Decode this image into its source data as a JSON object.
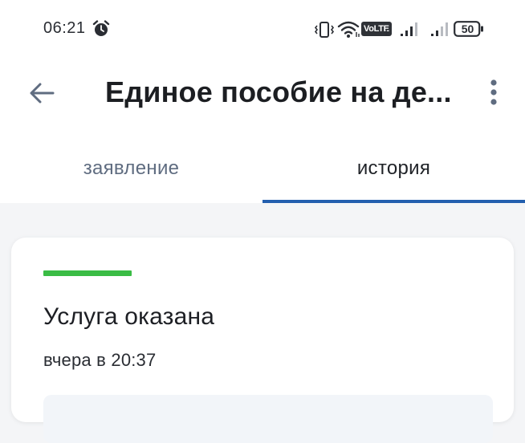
{
  "status_bar": {
    "time": "06:21",
    "volte": "VoLTE",
    "sim_index": "1",
    "battery": "50",
    "icons": [
      "alarm-icon",
      "vibrate-icon",
      "wifi-icon",
      "signal-icon",
      "battery-icon"
    ]
  },
  "header": {
    "title": "Единое пособие на де...",
    "back_icon": "arrow-left-icon",
    "more_icon": "more-vertical-icon"
  },
  "tabs": [
    {
      "label": "заявление",
      "active": false
    },
    {
      "label": "история",
      "active": true
    }
  ],
  "colors": {
    "accent": "#235fae",
    "success": "#3abc45",
    "inactive_tab": "#5f6c80"
  },
  "history": {
    "items": [
      {
        "status": "Услуга оказана",
        "time": "вчера в 20:37"
      }
    ]
  }
}
